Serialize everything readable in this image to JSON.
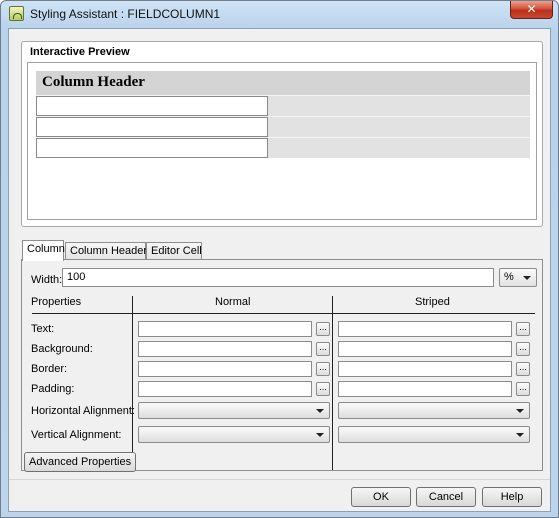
{
  "window": {
    "title": "Styling Assistant : FIELDCOLUMN1",
    "close_glyph": "✕"
  },
  "preview": {
    "legend": "Interactive Preview",
    "column_header": "Column Header"
  },
  "tabs": [
    {
      "label": "Column",
      "active": true
    },
    {
      "label": "Column Header",
      "active": false
    },
    {
      "label": "Editor Cell",
      "active": false
    }
  ],
  "width": {
    "label": "Width:",
    "value": "100",
    "unit": "%"
  },
  "columns": {
    "properties": "Properties",
    "normal": "Normal",
    "striped": "Striped"
  },
  "rows": {
    "text": "Text:",
    "background": "Background:",
    "border": "Border:",
    "padding": "Padding:",
    "horizontal_alignment": "Horizontal Alignment:",
    "vertical_alignment": "Vertical Alignment:"
  },
  "browse_glyph": "...",
  "buttons": {
    "advanced": "Advanced Properties",
    "ok": "OK",
    "cancel": "Cancel",
    "help": "Help"
  }
}
